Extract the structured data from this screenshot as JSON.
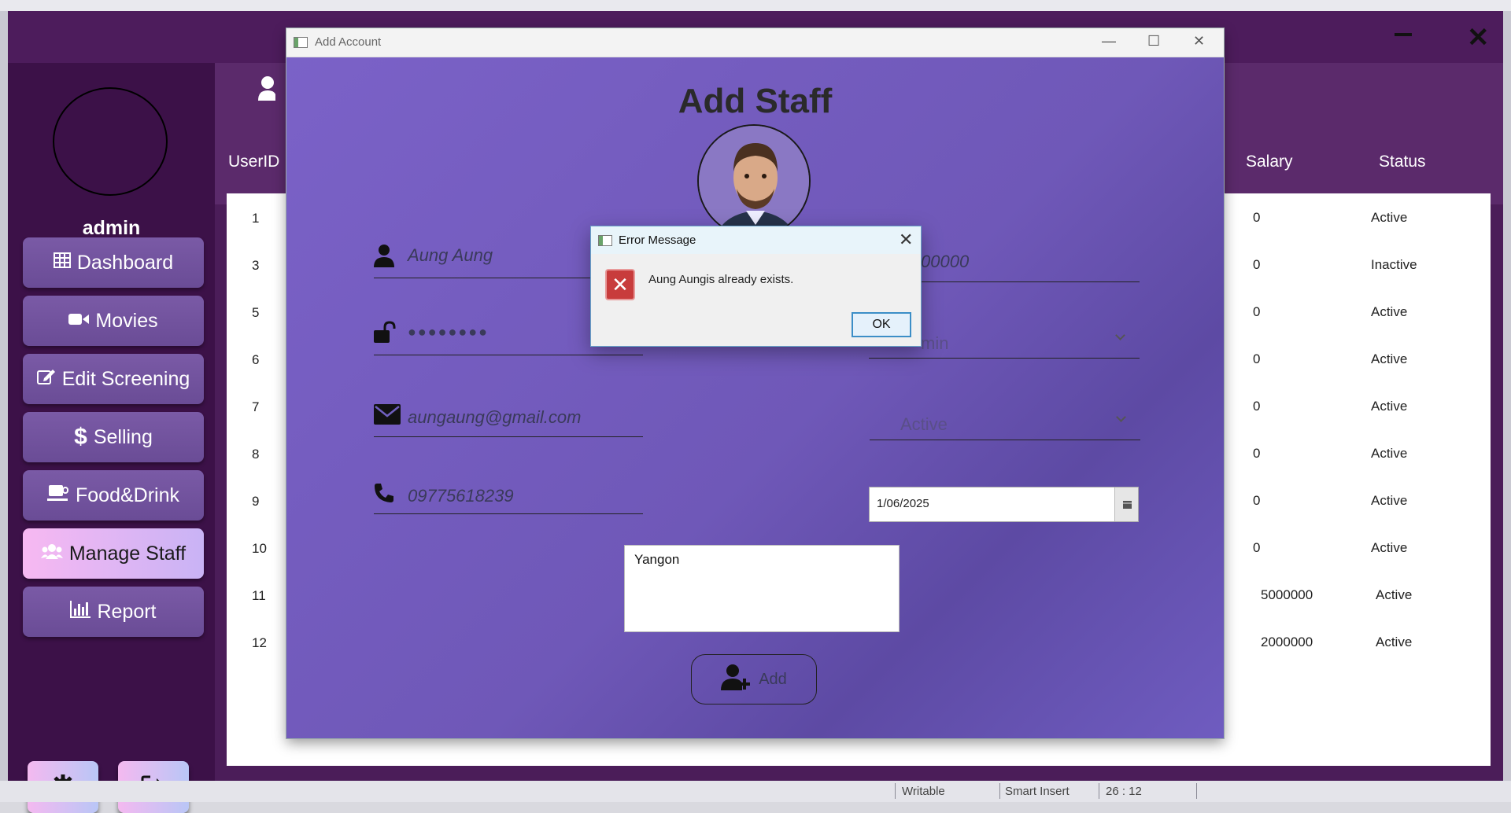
{
  "status_bar": {
    "writable": "Writable",
    "insert_mode": "Smart Insert",
    "position": "26 : 12"
  },
  "app": {
    "user_name": "admin"
  },
  "sidebar": {
    "items": [
      {
        "label": "Dashboard",
        "icon": "table-icon"
      },
      {
        "label": "Movies",
        "icon": "video-camera-icon"
      },
      {
        "label": "Edit Screening",
        "icon": "edit-icon"
      },
      {
        "label": "Selling",
        "icon": "dollar-icon"
      },
      {
        "label": "Food&Drink",
        "icon": "coffee-cup-icon"
      },
      {
        "label": "Manage Staff",
        "icon": "users-icon",
        "active": true
      },
      {
        "label": "Report",
        "icon": "bar-chart-icon"
      }
    ],
    "bottom_buttons": [
      "gear-icon",
      "logout-icon"
    ]
  },
  "table": {
    "headers": {
      "userid": "UserID",
      "salary": "Salary",
      "status": "Status"
    },
    "rows": [
      {
        "id": "1",
        "salary": "0",
        "status": "Active"
      },
      {
        "id": "3",
        "salary": "0",
        "status": "Inactive"
      },
      {
        "id": "5",
        "salary": "0",
        "status": "Active"
      },
      {
        "id": "6",
        "salary": "0",
        "status": "Active"
      },
      {
        "id": "7",
        "salary": "0",
        "status": "Active"
      },
      {
        "id": "8",
        "salary": "0",
        "status": "Active"
      },
      {
        "id": "9",
        "salary": "0",
        "status": "Active"
      },
      {
        "id": "10",
        "salary": "0",
        "status": "Active"
      },
      {
        "id": "11",
        "salary": "5000000",
        "status": "Active"
      },
      {
        "id": "12",
        "salary": "2000000",
        "status": "Active"
      }
    ]
  },
  "dialog": {
    "window_title": "Add Account",
    "heading": "Add Staff",
    "name_value": "Aung Aung",
    "password_mask": "●●●●●●●●",
    "email_value": "aungaung@gmail.com",
    "phone_value": "09775618239",
    "salary_value": "00000",
    "role_value": "min",
    "status_value": "Active",
    "date_value": "1/06/2025",
    "address_value": "Yangon",
    "add_label": "Add"
  },
  "error_dialog": {
    "title": "Error Message",
    "message": "Aung Aungis already exists.",
    "ok_label": "OK"
  },
  "colors": {
    "sidebar_bg": "#3c1148",
    "header_bg": "#5b2a6b",
    "dialog_bg": "#7060be",
    "active_nav": "#f7b8f2",
    "error_red": "#c83c3c"
  }
}
